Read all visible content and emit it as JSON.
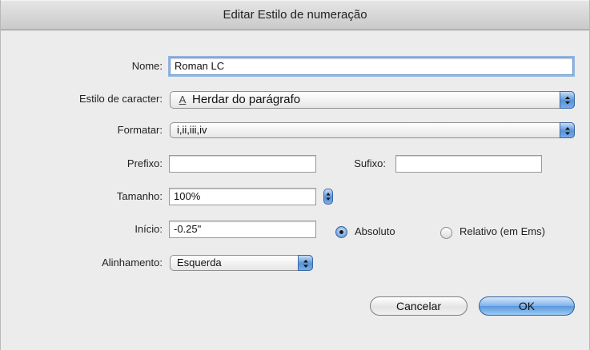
{
  "dialog": {
    "title": "Editar Estilo de numeração"
  },
  "form": {
    "nome_label": "Nome:",
    "nome_value": "Roman LC",
    "estilo_label": "Estilo de caracter:",
    "estilo_icon_glyph": "A",
    "estilo_value": "Herdar do parágrafo",
    "formatar_label": "Formatar:",
    "formatar_value": "i,ii,iii,iv",
    "prefixo_label": "Prefixo:",
    "prefixo_value": "",
    "sufixo_label": "Sufixo:",
    "sufixo_value": "",
    "tamanho_label": "Tamanho:",
    "tamanho_value": "100%",
    "inicio_label": "Início:",
    "inicio_value": "-0.25\"",
    "absoluto_label": "Absoluto",
    "absoluto_selected": true,
    "relativo_label": "Relativo (em Ems)",
    "relativo_selected": false,
    "alinhamento_label": "Alinhamento:",
    "alinhamento_value": "Esquerda"
  },
  "buttons": {
    "cancel_label": "Cancelar",
    "ok_label": "OK"
  },
  "colors": {
    "window_bg": "#ececec",
    "accent_blue": "#5a93d6",
    "focus_ring": "#8fb6e4"
  },
  "icons": {
    "popup_arrows": "updown-chevron-icon",
    "character_style": "character-style-icon"
  }
}
